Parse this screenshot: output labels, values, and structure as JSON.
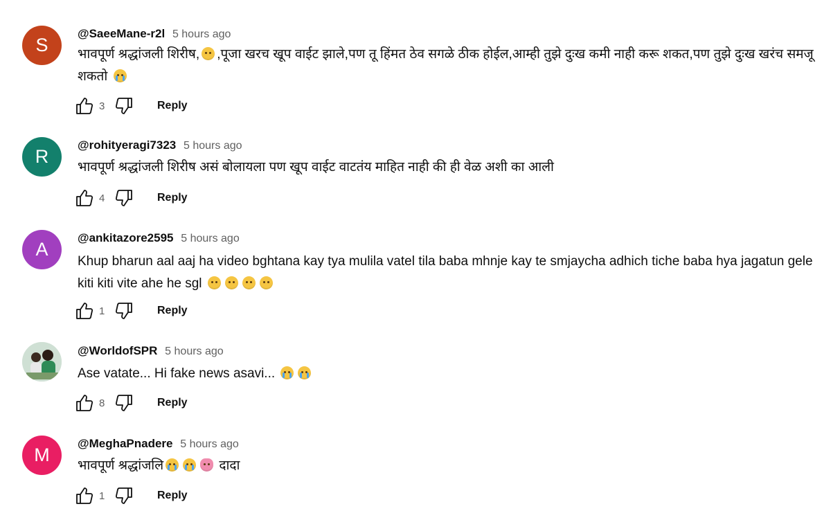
{
  "comments": [
    {
      "avatar_letter": "S",
      "avatar_color": "#c3421b",
      "handle": "@SaeeMane-r2l",
      "time": "5 hours ago",
      "text_parts": [
        "भावपूर्ण श्रद्धांजली शिरीष,",
        ",पूजा खरच खूप वाईट झाले,पण तू हिंमत ठेव सगळे ठीक होईल,आम्ही तुझे दुःख कमी नाही करू शकत,पण तुझे दुःख खरंच समजू शकतो "
      ],
      "likes": "3",
      "reply_label": "Reply"
    },
    {
      "avatar_letter": "R",
      "avatar_color": "#13806c",
      "handle": "@rohityeragi7323",
      "time": "5 hours ago",
      "text": "भावपूर्ण श्रद्धांजली शिरीष असं बोलायला पण खूप वाईट वाटतंय माहित नाही की ही वेळ अशी का आली",
      "likes": "4",
      "reply_label": "Reply"
    },
    {
      "avatar_letter": "A",
      "avatar_color": "#a13fbf",
      "handle": "@ankitazore2595",
      "time": "5 hours ago",
      "text": "Khup bharun aal aaj ha video bghtana kay tya mulila vatel tila baba mhnje kay te smjaycha adhich tiche baba hya jagatun gele kiti kiti vite ahe he sgl",
      "likes": "1",
      "reply_label": "Reply"
    },
    {
      "avatar_letter": "",
      "avatar_color": "#d9e4dc",
      "handle": "@WorldofSPR",
      "time": "5 hours ago",
      "text": "Ase vatate... Hi fake news asavi...",
      "likes": "8",
      "reply_label": "Reply"
    },
    {
      "avatar_letter": "M",
      "avatar_color": "#e91e63",
      "handle": "@MeghaPnadere",
      "time": "5 hours ago",
      "text_parts": [
        "भावपूर्ण श्रद्धांजलि",
        " दादा"
      ],
      "likes": "1",
      "reply_label": "Reply"
    }
  ],
  "icons": {
    "like": "thumbs-up-icon",
    "dislike": "thumbs-down-icon",
    "sad_emoji": "sad-face-emoji",
    "crying_emoji": "crying-face-emoji",
    "bouquet_emoji": "bouquet-emoji"
  }
}
